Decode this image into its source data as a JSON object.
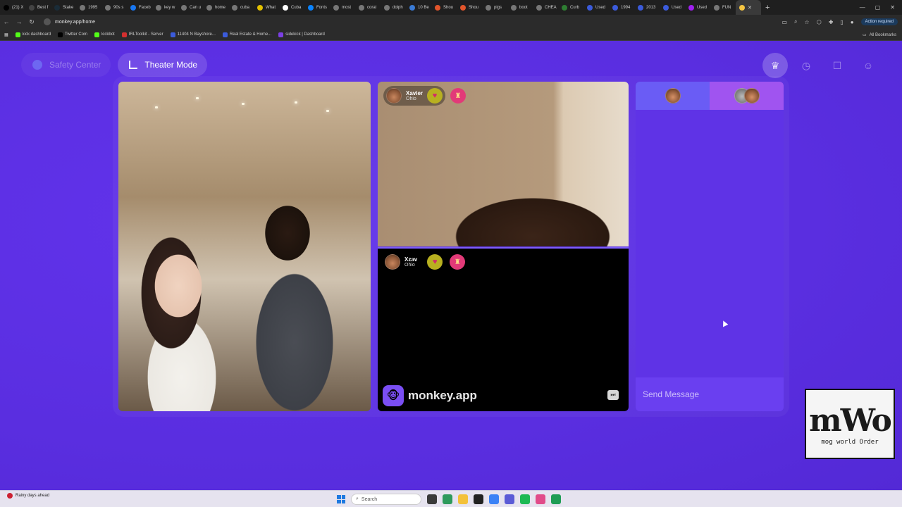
{
  "browser": {
    "tabs": [
      {
        "label": "(21) X",
        "color": "#000000"
      },
      {
        "label": "Best f",
        "color": "#444444"
      },
      {
        "label": "Stake",
        "color": "#1a2c38"
      },
      {
        "label": "1995",
        "color": "#777777"
      },
      {
        "label": "90s s",
        "color": "#777777"
      },
      {
        "label": "Faceb",
        "color": "#1877f2"
      },
      {
        "label": "key w",
        "color": "#777777"
      },
      {
        "label": "Can u",
        "color": "#777777"
      },
      {
        "label": "home",
        "color": "#777777"
      },
      {
        "label": "cuba",
        "color": "#777777"
      },
      {
        "label": "What",
        "color": "#e2c000"
      },
      {
        "label": "Cuba",
        "color": "#ffffff"
      },
      {
        "label": "Fonts",
        "color": "#0a84ff"
      },
      {
        "label": "most",
        "color": "#777777"
      },
      {
        "label": "coral",
        "color": "#777777"
      },
      {
        "label": "dolph",
        "color": "#777777"
      },
      {
        "label": "10 Be",
        "color": "#3a7bd5"
      },
      {
        "label": "Shou",
        "color": "#e2552b"
      },
      {
        "label": "Shou",
        "color": "#e2552b"
      },
      {
        "label": "pigs",
        "color": "#777777"
      },
      {
        "label": "boot",
        "color": "#777777"
      },
      {
        "label": "CHEA",
        "color": "#777777"
      },
      {
        "label": "Curb",
        "color": "#2e7d32"
      },
      {
        "label": "Used",
        "color": "#3b5bdb"
      },
      {
        "label": "1994",
        "color": "#3b5bdb"
      },
      {
        "label": "2013",
        "color": "#3b5bdb"
      },
      {
        "label": "Used",
        "color": "#3b5bdb"
      },
      {
        "label": "Used",
        "color": "#a020f0"
      },
      {
        "label": "FUN",
        "color": "#777777"
      }
    ],
    "active_tab_label": "",
    "url": "monkey.app/home",
    "action_required": "Action required",
    "bookmarks": [
      {
        "label": "kick dashboard",
        "color": "#53fc18"
      },
      {
        "label": "Twitter Com",
        "color": "#000000"
      },
      {
        "label": "kickbot",
        "color": "#53fc18"
      },
      {
        "label": "IRLToolkit - Server",
        "color": "#d32f2f"
      },
      {
        "label": "11404 N Bayshore...",
        "color": "#3b5bdb"
      },
      {
        "label": "Real Estate & Home...",
        "color": "#3b5bdb"
      },
      {
        "label": "sidekick | Dashboard",
        "color": "#7b3fe4"
      }
    ],
    "all_bookmarks": "All Bookmarks"
  },
  "topbar": {
    "safety_label": "Safety Center",
    "theater_label": "Theater Mode"
  },
  "rightnav": {
    "icons": [
      "crown-icon",
      "clock-icon",
      "chat-icon",
      "profile-icon"
    ]
  },
  "video_top": {
    "user": {
      "name": "Xavier",
      "location": "Ohio"
    }
  },
  "video_bottom": {
    "user": {
      "name": "Xzav",
      "location": "Ohio"
    },
    "brand": "monkey.app"
  },
  "chat": {
    "placeholder": "Send Message"
  },
  "watermark": {
    "big": "mWo",
    "small": "mog world Order"
  },
  "taskbar": {
    "weather": "Rainy days ahead",
    "search_placeholder": "Search"
  },
  "colors": {
    "page_bg": "#5a2ee0",
    "chat_tab_1": "#6a5cf5",
    "chat_tab_2": "#a054f0",
    "heart_chip": "#b8b020",
    "gift_chip": "#e23a78"
  }
}
